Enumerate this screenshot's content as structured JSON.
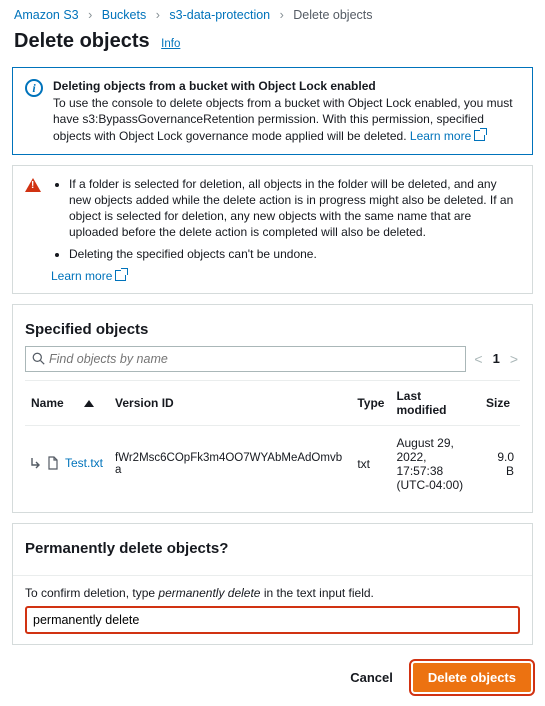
{
  "breadcrumb": {
    "items": [
      "Amazon S3",
      "Buckets",
      "s3-data-protection",
      "Delete objects"
    ]
  },
  "page": {
    "title": "Delete objects",
    "info_link": "Info"
  },
  "objectlock_notice": {
    "heading": "Deleting objects from a bucket with Object Lock enabled",
    "body": "To use the console to delete objects from a bucket with Object Lock enabled, you must have s3:BypassGovernanceRetention permission. With this permission, specified objects with Object Lock governance mode applied will be deleted.",
    "learn_more": "Learn more"
  },
  "warning": {
    "bullets": [
      "If a folder is selected for deletion, all objects in the folder will be deleted, and any new objects added while the delete action is in progress might also be deleted. If an object is selected for deletion, any new objects with the same name that are uploaded before the delete action is completed will also be deleted.",
      "Deleting the specified objects can't be undone."
    ],
    "learn_more": "Learn more"
  },
  "specified": {
    "title": "Specified objects",
    "search_placeholder": "Find objects by name",
    "page": "1",
    "columns": {
      "name": "Name",
      "version": "Version ID",
      "type": "Type",
      "last_modified": "Last modified",
      "size": "Size"
    },
    "rows": [
      {
        "name": "Test.txt",
        "version": "fWr2Msc6COpFk3m4OO7WYAbMeAdOmvba",
        "type": "txt",
        "last_modified": "August 29, 2022, 17:57:38 (UTC-04:00)",
        "size": "9.0 B"
      }
    ]
  },
  "confirm": {
    "title": "Permanently delete objects?",
    "instruction_prefix": "To confirm deletion, type ",
    "instruction_phrase": "permanently delete",
    "instruction_suffix": " in the text input field.",
    "value": "permanently delete"
  },
  "footer": {
    "cancel": "Cancel",
    "delete": "Delete objects"
  }
}
